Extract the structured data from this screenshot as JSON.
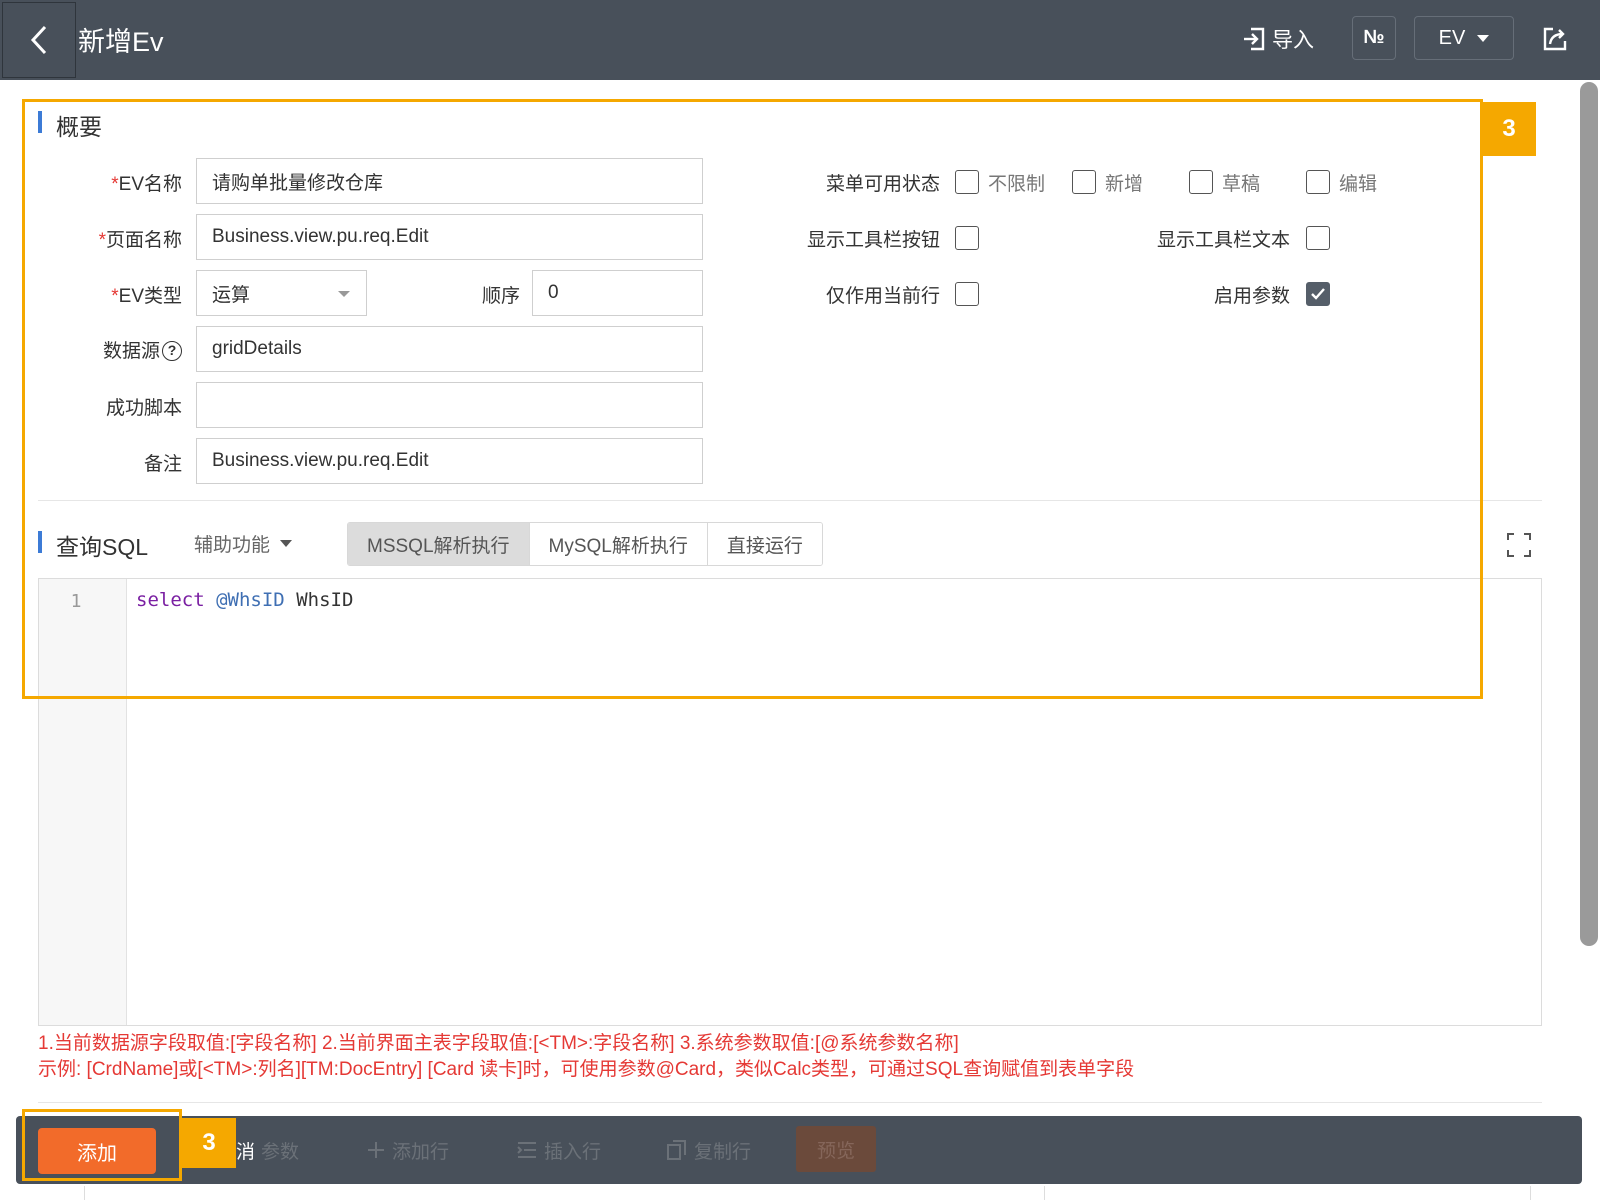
{
  "header": {
    "title": "新增Ev",
    "import_label": "导入",
    "no_label": "№",
    "ev_dropdown": "EV"
  },
  "overview": {
    "section_title": "概要",
    "fields": {
      "ev_name": {
        "label": "EV名称",
        "value": "请购单批量修改仓库"
      },
      "page_name": {
        "label": "页面名称",
        "value": "Business.view.pu.req.Edit"
      },
      "ev_type": {
        "label": "EV类型",
        "value": "运算"
      },
      "order": {
        "label": "顺序",
        "value": "0"
      },
      "data_source": {
        "label": "数据源",
        "value": "gridDetails"
      },
      "success_script": {
        "label": "成功脚本",
        "value": ""
      },
      "remark": {
        "label": "备注",
        "value": "Business.view.pu.req.Edit"
      }
    },
    "menu_state": {
      "label": "菜单可用状态",
      "options": [
        {
          "label": "不限制",
          "checked": false
        },
        {
          "label": "新增",
          "checked": false
        },
        {
          "label": "草稿",
          "checked": false
        },
        {
          "label": "编辑",
          "checked": false
        }
      ]
    },
    "toggles": {
      "show_toolbar_button": {
        "label": "显示工具栏按钮",
        "checked": false
      },
      "show_toolbar_text": {
        "label": "显示工具栏文本",
        "checked": false
      },
      "current_row_only": {
        "label": "仅作用当前行",
        "checked": false
      },
      "enable_params": {
        "label": "启用参数",
        "checked": true
      }
    }
  },
  "sql": {
    "section_title": "查询SQL",
    "helper_label": "辅助功能",
    "modes": [
      {
        "label": "MSSQL解析执行",
        "active": true
      },
      {
        "label": "MySQL解析执行",
        "active": false
      },
      {
        "label": "直接运行",
        "active": false
      }
    ],
    "line_number": "1",
    "code": {
      "keyword": "select",
      "variable": "@WhsID",
      "alias": "WhsID"
    },
    "hint_line1": "1.当前数据源字段取值:[字段名称]  2.当前界面主表字段取值:[<TM>:字段名称]  3.系统参数取值:[@系统参数名称]",
    "hint_line2": "示例: [CrdName]或[<TM>:列名][TM:DocEntry] [Card 读卡]时，可使用参数@Card，类似Calc类型，可通过SQL查询赋值到表单字段"
  },
  "bottom_toolbar": {
    "add_label": "添加",
    "cancel_params_partial": "消",
    "cancel_params_label": "参数",
    "add_row_label": "添加行",
    "insert_row_label": "插入行",
    "copy_row_label": "复制行",
    "preview_label": "预览"
  },
  "annotations": {
    "badge_top": "3",
    "badge_bottom": "3"
  },
  "colors": {
    "header_bg": "#48505a",
    "accent_blue": "#3c7bd6",
    "highlight": "#f5a800",
    "add_button": "#f26b2a",
    "hint_red": "#e53935"
  }
}
